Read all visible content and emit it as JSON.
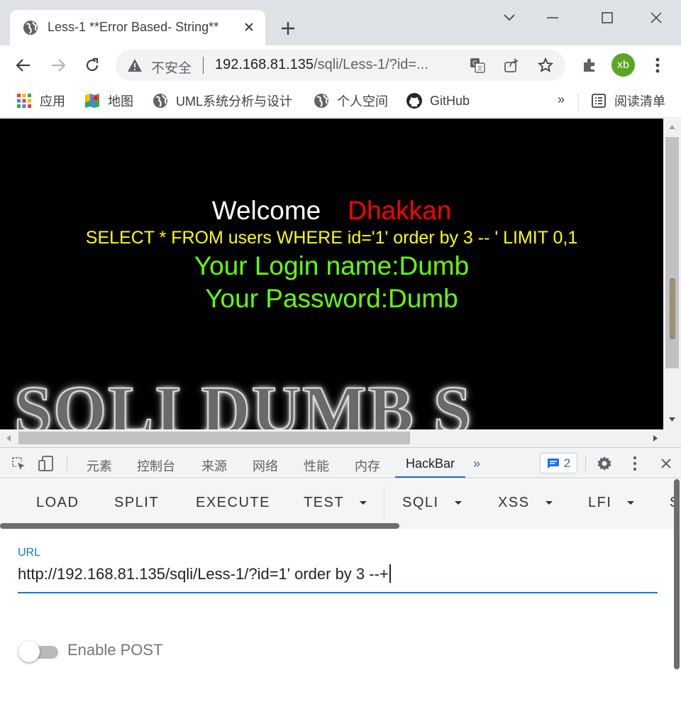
{
  "browser": {
    "tab": {
      "title": "Less-1 **Error Based- String**",
      "close_glyph": "✕"
    },
    "new_tab_glyph": "+",
    "window": {
      "minimize_glyph": "⌄",
      "maximize_glyph": "☐",
      "close_glyph": "✕"
    }
  },
  "toolbar": {
    "security_label": "不安全",
    "url_host": "192.168.81.135",
    "url_path": "/sqli/Less-1/?id=...",
    "avatar_initials": "xb",
    "avatar_color": "#5aa628"
  },
  "bookmarks": {
    "items": [
      {
        "label": "应用",
        "icon": "apps-grid-icon"
      },
      {
        "label": "地图",
        "icon": "maps-icon"
      },
      {
        "label": "UML系统分析与设计",
        "icon": "globe-icon"
      },
      {
        "label": "个人空间",
        "icon": "globe-icon"
      },
      {
        "label": "GitHub",
        "icon": "github-icon"
      }
    ],
    "more_glyph": "»",
    "reading_list": "阅读清单"
  },
  "page": {
    "welcome": "Welcome",
    "name": "Dhakkan",
    "query": "SELECT * FROM users WHERE id='1' order by 3 -- ' LIMIT 0,1",
    "login": "Your Login name:Dumb",
    "password": "Your Password:Dumb",
    "logo_text": "SQLI DUMB S",
    "colors": {
      "background": "#000000",
      "welcome": "#ffffff",
      "name": "#ff0000",
      "query": "#ffff00",
      "result": "#66ff00"
    }
  },
  "devtools": {
    "tabs": [
      "元素",
      "控制台",
      "来源",
      "网络",
      "性能",
      "内存",
      "HackBar"
    ],
    "active_tab": "HackBar",
    "more_glyph": "»",
    "issues_count": "2"
  },
  "hackbar": {
    "buttons": [
      {
        "label": "LOAD",
        "dropdown": false
      },
      {
        "label": "SPLIT",
        "dropdown": false
      },
      {
        "label": "EXECUTE",
        "dropdown": false
      },
      {
        "label": "TEST",
        "dropdown": true
      },
      {
        "label": "SQLI",
        "dropdown": true
      },
      {
        "label": "XSS",
        "dropdown": true
      },
      {
        "label": "LFI",
        "dropdown": true
      },
      {
        "label": "S",
        "dropdown": false
      }
    ],
    "url_label": "URL",
    "url_value": "http://192.168.81.135/sqli/Less-1/?id=1' order by 3 --+",
    "enable_post_label": "Enable POST",
    "enable_post": false,
    "accent": "#1976d2"
  }
}
